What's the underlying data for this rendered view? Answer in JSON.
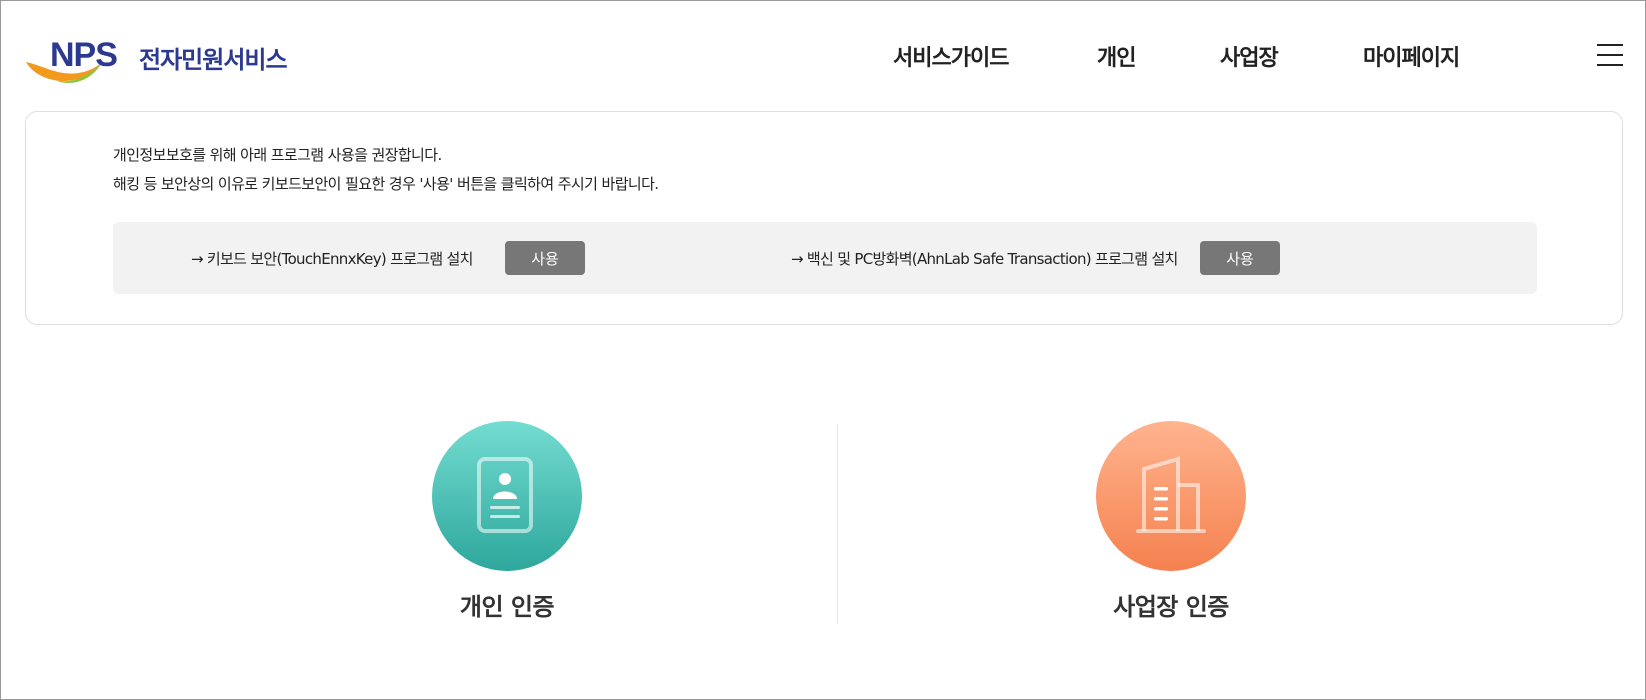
{
  "header": {
    "logo": {
      "brand": "NPS",
      "service_name": "전자민원서비스"
    },
    "nav": [
      "서비스가이드",
      "개인",
      "사업장",
      "마이페이지"
    ]
  },
  "notice": {
    "line1": "개인정보보호를 위해 아래 프로그램 사용을 권장합니다.",
    "line2": "해킹 등 보안상의 이유로 키보드보안이 필요한 경우 '사용' 버튼을 클릭하여 주시기 바랍니다.",
    "programs": [
      {
        "label": "→ 키보드 보안(TouchEnnxKey) 프로그램 설치",
        "button": "사용"
      },
      {
        "label": "→ 백신 및 PC방화벽(AhnLab Safe Transaction) 프로그램 설치",
        "button": "사용"
      }
    ]
  },
  "auth": {
    "personal": {
      "label": "개인 인증",
      "icon": "id-card-icon",
      "color": "#3fb7ab"
    },
    "business": {
      "label": "사업장 인증",
      "icon": "building-icon",
      "color": "#f7905f"
    }
  },
  "colors": {
    "brand": "#2b3990",
    "button": "#777777",
    "teal": "#3fb7ab",
    "orange": "#f7905f"
  }
}
